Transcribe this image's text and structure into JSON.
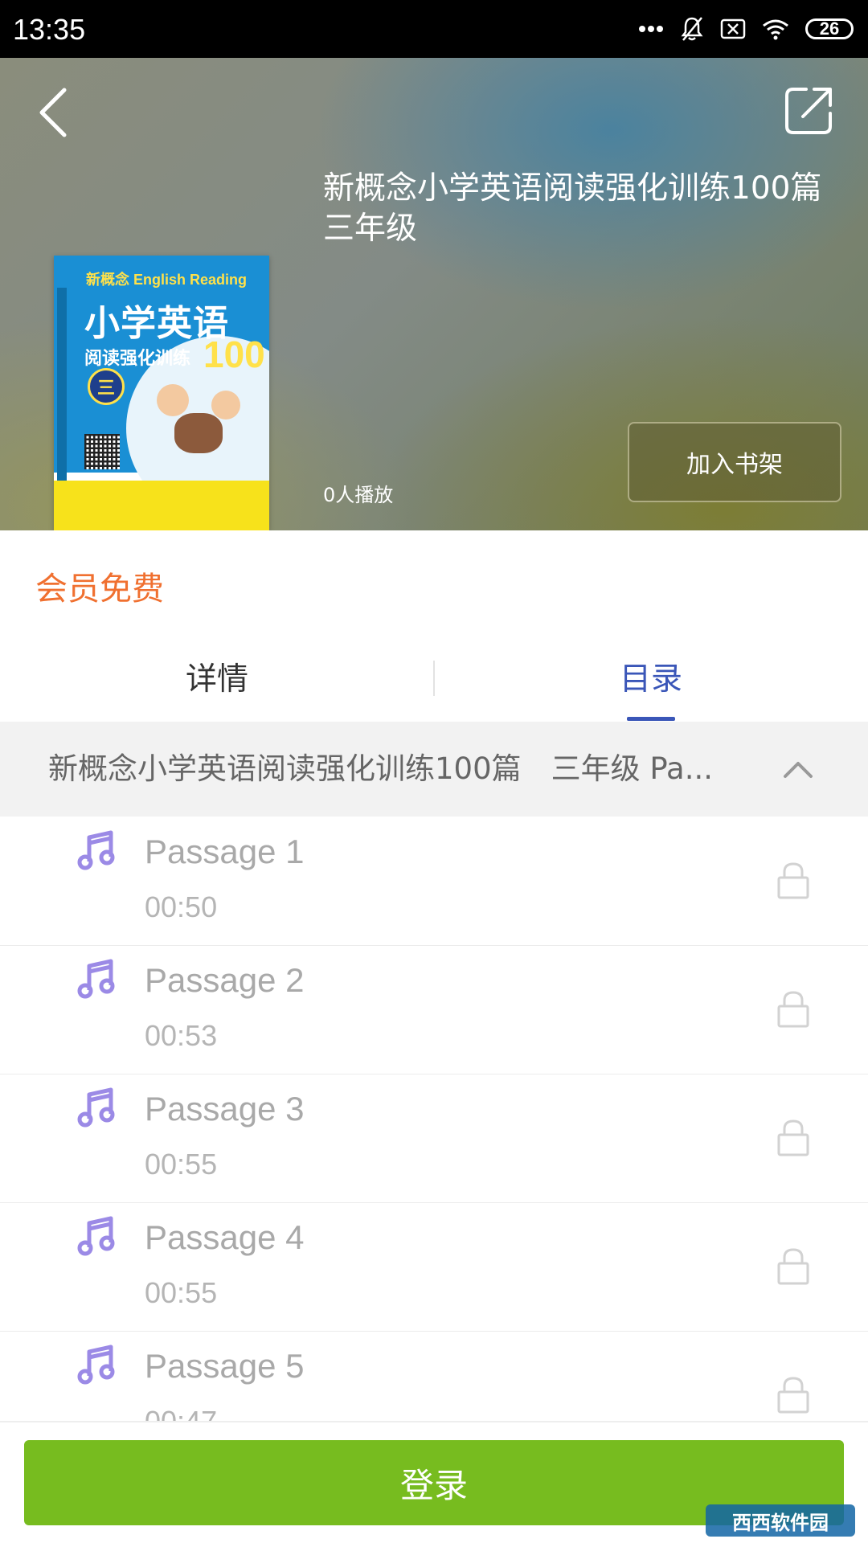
{
  "status_bar": {
    "time": "13:35",
    "battery": "26"
  },
  "header": {
    "book_title": "新概念小学英语阅读强化训练100篇　三年级",
    "plays": "0人播放",
    "add_to_shelf": "加入书架"
  },
  "cover": {
    "brand": "新概念 English Reading",
    "main_title": "小学英语",
    "subtitle": "阅读强化训练",
    "number": "100",
    "grade": "三"
  },
  "member_free": "会员免费",
  "tabs": [
    {
      "label": "详情",
      "active": false
    },
    {
      "label": "目录",
      "active": true
    }
  ],
  "section": {
    "title": "新概念小学英语阅读强化训练100篇　三年级 Pa..."
  },
  "passages": [
    {
      "title": "Passage 1",
      "duration": "00:50"
    },
    {
      "title": "Passage 2",
      "duration": "00:53"
    },
    {
      "title": "Passage 3",
      "duration": "00:55"
    },
    {
      "title": "Passage 4",
      "duration": "00:55"
    },
    {
      "title": "Passage 5",
      "duration": "00:47"
    }
  ],
  "login_button": "登录",
  "watermark": "西西软件园",
  "colors": {
    "accent": "#3a56b8",
    "member": "#f07030",
    "login": "#77bc1f",
    "note_icon": "#9b8ae6"
  },
  "icons": {
    "back": "chevron-left-icon",
    "share": "share-icon",
    "collapse": "chevron-up-icon",
    "track": "music-note-icon",
    "locked": "lock-icon"
  }
}
